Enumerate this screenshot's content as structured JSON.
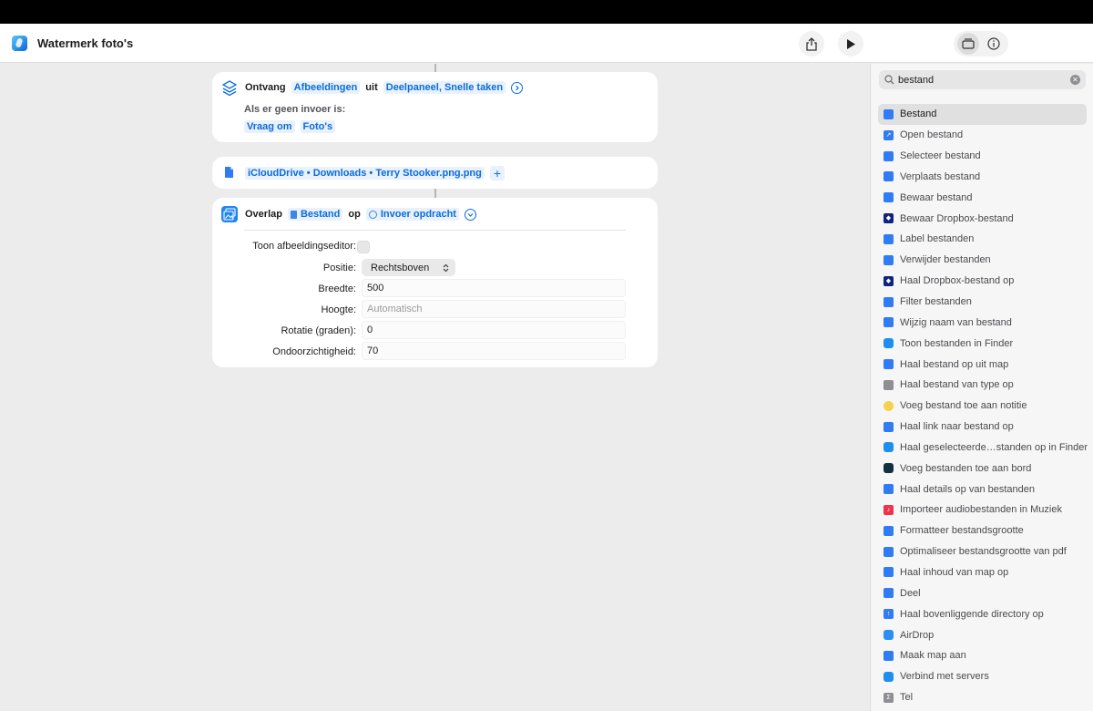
{
  "window": {
    "title": "Watermerk foto's"
  },
  "cards": {
    "receive": {
      "keyword": "Ontvang",
      "input_type": "Afbeeldingen",
      "from_word": "uit",
      "sources": "Deelpaneel, Snelle taken",
      "no_input_label": "Als er geen invoer is:",
      "fallback_action": "Vraag om",
      "fallback_type": "Foto's"
    },
    "file": {
      "path": "iCloudDrive • Downloads • Terry Stooker.png.png",
      "add": "+"
    },
    "overlay": {
      "keyword": "Overlap",
      "file_token": "Bestand",
      "on_word": "op",
      "target_token": "Invoer opdracht",
      "fields": {
        "editor_label": "Toon afbeeldingseditor:",
        "position_label": "Positie:",
        "position_value": "Rechtsboven",
        "width_label": "Breedte:",
        "width_value": "500",
        "height_label": "Hoogte:",
        "height_placeholder": "Automatisch",
        "rotation_label": "Rotatie (graden):",
        "rotation_value": "0",
        "opacity_label": "Ondoorzichtigheid:",
        "opacity_value": "70"
      }
    }
  },
  "sidebar": {
    "search_value": "bestand",
    "items": [
      {
        "label": "Bestand",
        "icon": "file-icon",
        "color": "#2f7cf6"
      },
      {
        "label": "Open bestand",
        "icon": "open-arrow-icon",
        "color": "#2f7cf6"
      },
      {
        "label": "Selecteer bestand",
        "icon": "file-icon",
        "color": "#2f7cf6"
      },
      {
        "label": "Verplaats bestand",
        "icon": "folder-icon",
        "color": "#2f7cf6"
      },
      {
        "label": "Bewaar bestand",
        "icon": "save-icon",
        "color": "#2f7cf6"
      },
      {
        "label": "Bewaar Dropbox-bestand",
        "icon": "dropbox-icon",
        "color": "#0d2481"
      },
      {
        "label": "Label bestanden",
        "icon": "tag-icon",
        "color": "#2f7cf6"
      },
      {
        "label": "Verwijder bestanden",
        "icon": "trash-icon",
        "color": "#2f7cf6"
      },
      {
        "label": "Haal Dropbox-bestand op",
        "icon": "dropbox-icon",
        "color": "#0d2481"
      },
      {
        "label": "Filter bestanden",
        "icon": "filter-icon",
        "color": "#2f7cf6"
      },
      {
        "label": "Wijzig naam van bestand",
        "icon": "rename-icon",
        "color": "#2f7cf6"
      },
      {
        "label": "Toon bestanden in Finder",
        "icon": "finder-icon",
        "color": "#1e8ff0"
      },
      {
        "label": "Haal bestand op uit map",
        "icon": "folder-icon",
        "color": "#2f7cf6"
      },
      {
        "label": "Haal bestand van type op",
        "icon": "search-file-icon",
        "color": "#8e8e93"
      },
      {
        "label": "Voeg bestand toe aan notitie",
        "icon": "notes-icon",
        "color": "#f5d24a"
      },
      {
        "label": "Haal link naar bestand op",
        "icon": "cloud-icon",
        "color": "#2f7cf6"
      },
      {
        "label": "Haal geselecteerde…standen op in Finder",
        "icon": "finder-icon",
        "color": "#1e8ff0"
      },
      {
        "label": "Voeg bestanden toe aan bord",
        "icon": "freeform-icon",
        "color": "#12303f"
      },
      {
        "label": "Haal details op van bestanden",
        "icon": "details-icon",
        "color": "#2f7cf6"
      },
      {
        "label": "Importeer audiobestanden in Muziek",
        "icon": "music-icon",
        "color": "#f3314b"
      },
      {
        "label": "Formatteer bestandsgrootte",
        "icon": "file-icon",
        "color": "#2f7cf6"
      },
      {
        "label": "Optimaliseer bestandsgrootte van pdf",
        "icon": "compress-icon",
        "color": "#2f7cf6"
      },
      {
        "label": "Haal inhoud van map op",
        "icon": "folder-icon",
        "color": "#2f7cf6"
      },
      {
        "label": "Deel",
        "icon": "share-icon",
        "color": "#2f7cf6"
      },
      {
        "label": "Haal bovenliggende directory op",
        "icon": "up-arrow-icon",
        "color": "#2f7cf6"
      },
      {
        "label": "AirDrop",
        "icon": "airdrop-icon",
        "color": "#2a8ef5"
      },
      {
        "label": "Maak map aan",
        "icon": "folder-icon",
        "color": "#2f7cf6"
      },
      {
        "label": "Verbind met servers",
        "icon": "finder-icon",
        "color": "#1e8ff0"
      },
      {
        "label": "Tel",
        "icon": "count-icon",
        "color": "#8e8e93"
      }
    ]
  }
}
